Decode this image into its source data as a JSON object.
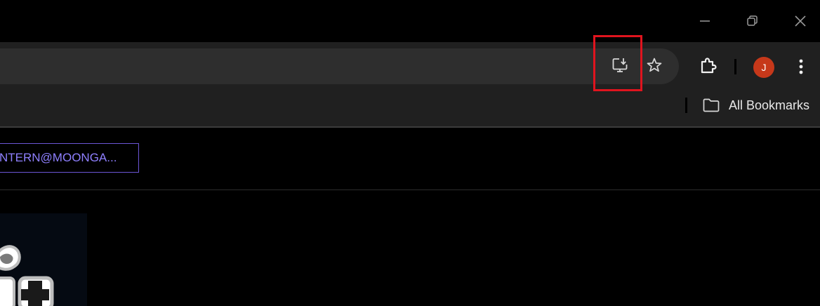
{
  "window_controls": {
    "minimize_icon": "minimize-icon",
    "restore_icon": "restore-icon",
    "close_icon": "close-icon"
  },
  "toolbar": {
    "install_icon": "install-app-icon",
    "bookmark_star_icon": "star-icon",
    "extensions_icon": "puzzle-icon",
    "profile_initial": "J",
    "profile_color": "#c6381a",
    "menu_icon": "kebab-menu-icon",
    "highlight_color": "#e0141e"
  },
  "bookmarks": {
    "all_bookmarks_label": "All Bookmarks",
    "folder_icon": "folder-icon"
  },
  "page": {
    "email_text": "NTERN@MOONGA...",
    "email_color": "#8f80ff"
  }
}
